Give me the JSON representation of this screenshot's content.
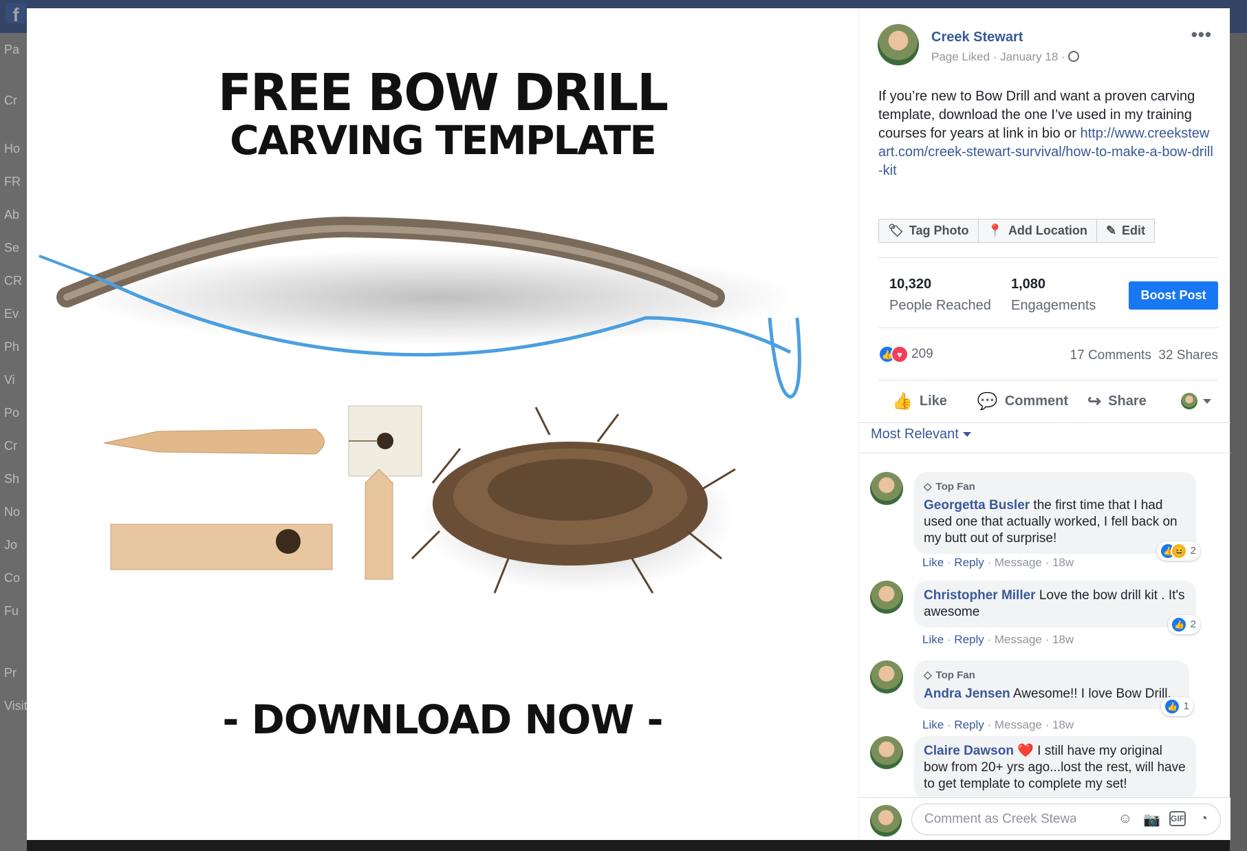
{
  "photo": {
    "title_line1": "FREE BOW DRILL",
    "title_line2": "CARVING TEMPLATE",
    "footer": "- DOWNLOAD NOW -"
  },
  "post": {
    "author": "Creek Stewart",
    "meta": "Page Liked · January 18 ·",
    "more_icon": "•••",
    "caption": "If you’re new to Bow Drill and want a proven carving template, download the one I’ve used in my training courses for years at link in bio or ",
    "link": "http://www.creekstewart.com/creek-stewart-survival/how-to-make-a-bow-drill-kit"
  },
  "actions": {
    "tag_photo": "Tag Photo",
    "add_location": "Add Location",
    "edit": "Edit"
  },
  "stats": {
    "reached_value": "10,320",
    "reached_label": "People Reached",
    "engagements_value": "1,080",
    "engagements_label": "Engagements",
    "boost": "Boost Post"
  },
  "reactions": {
    "count": "209",
    "comments": "17 Comments",
    "shares": "32 Shares"
  },
  "buttons": {
    "like": "Like",
    "comment": "Comment",
    "share": "Share"
  },
  "sort": {
    "label": "Most Relevant"
  },
  "comments": [
    {
      "badge": "Top Fan",
      "name": "Georgetta Busler",
      "text": " the first time that I had used one that actually worked, I fell back on my butt out of surprise!",
      "reactions": "2",
      "like": "Like",
      "reply": "Reply",
      "message": "Message",
      "time": "18w"
    },
    {
      "badge": "",
      "name": "Christopher Miller",
      "text": " Love the bow drill kit . It's awesome",
      "reactions": "2",
      "like": "Like",
      "reply": "Reply",
      "message": "Message",
      "time": "18w"
    },
    {
      "badge": "Top Fan",
      "name": "Andra Jensen",
      "text": " Awesome!! I love Bow Drill.",
      "reactions": "1",
      "like": "Like",
      "reply": "Reply",
      "message": "Message",
      "time": "18w"
    },
    {
      "badge": "",
      "name": "Claire Dawson",
      "heart": "❤️",
      "text": " I still have my original bow from 20+ yrs ago...lost the rest, will have to get template to complete my set!"
    }
  ],
  "composer": {
    "placeholder": "Comment as Creek Stewart"
  },
  "background": {
    "fb_logo": "f",
    "left_nav": [
      "Pa",
      "Cr",
      "Ho",
      "FR",
      "Ab",
      "Se",
      "CR",
      "Ev",
      "Ph",
      "Vi",
      "Po",
      "Cr",
      "Sh",
      "No",
      "Jo",
      "Co",
      "Fu",
      "Pr",
      "Visit"
    ]
  },
  "colors": {
    "link": "#385898",
    "boost": "#1877f2",
    "like_blue": "#1877f2",
    "love_red": "#f33e58"
  }
}
